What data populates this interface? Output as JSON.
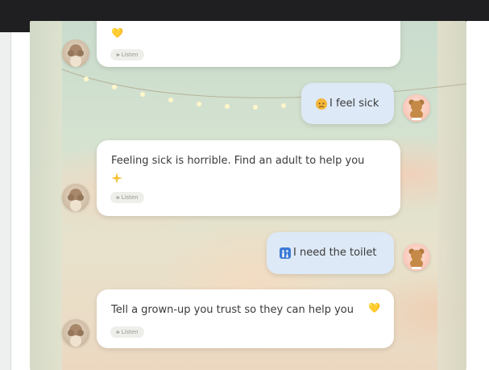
{
  "window": {
    "background_color": "#1f1f21"
  },
  "conversation": {
    "messages": [
      {
        "role": "assistant",
        "text": "",
        "trailing_emoji": "💛",
        "listen_label": "🕪 Listen"
      },
      {
        "role": "user",
        "text": "I feel sick",
        "leading_emoji": "sick-face-emoji"
      },
      {
        "role": "assistant",
        "text": "Feeling sick is horrible. Find an adult to help you",
        "trailing_emoji": "sparkle-emoji",
        "listen_label": "🕪 Listen"
      },
      {
        "role": "user",
        "text": "I need the toilet",
        "leading_emoji": "restroom-emoji"
      },
      {
        "role": "assistant",
        "text": "Tell a grown-up you trust so they can help you",
        "trailing_emoji": "💛",
        "listen_label": "🕪 Listen"
      }
    ]
  },
  "colors": {
    "assistant_bubble": "#ffffff",
    "user_bubble": "#dde9f6",
    "heart": "#f4c33b"
  }
}
